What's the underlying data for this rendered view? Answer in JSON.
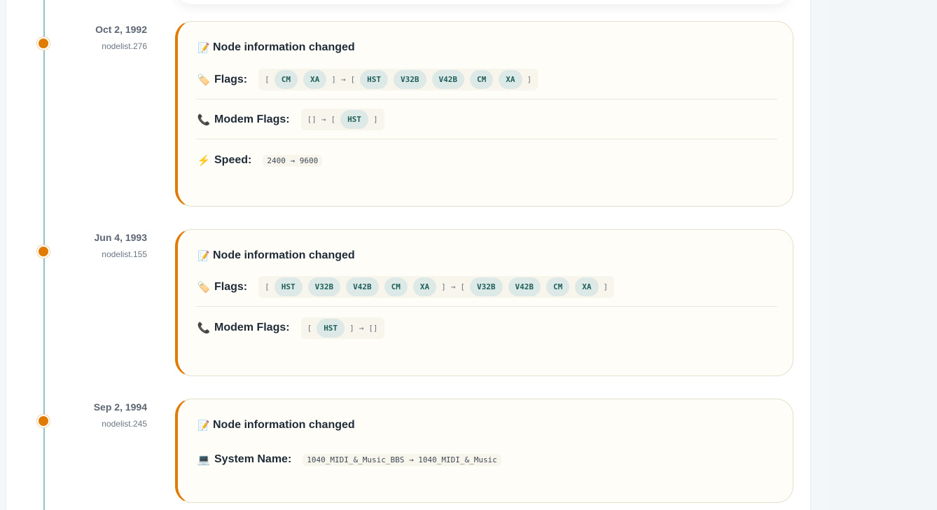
{
  "entries": [
    {
      "date": "Oct 2, 1992",
      "source": "nodelist.276",
      "title": "Node information changed",
      "rows": [
        {
          "label": "Flags:",
          "icon": "tag-icon",
          "from": [
            "CM",
            "XA"
          ],
          "to": [
            "HST",
            "V32B",
            "V42B",
            "CM",
            "XA"
          ]
        },
        {
          "label": "Modem Flags:",
          "icon": "phone-icon",
          "from": [],
          "to": [
            "HST"
          ]
        },
        {
          "label": "Speed:",
          "icon": "lightning-icon",
          "text": "2400 → 9600"
        }
      ]
    },
    {
      "date": "Jun 4, 1993",
      "source": "nodelist.155",
      "title": "Node information changed",
      "rows": [
        {
          "label": "Flags:",
          "icon": "tag-icon",
          "from": [
            "HST",
            "V32B",
            "V42B",
            "CM",
            "XA"
          ],
          "to": [
            "V32B",
            "V42B",
            "CM",
            "XA"
          ]
        },
        {
          "label": "Modem Flags:",
          "icon": "phone-icon",
          "from": [
            "HST"
          ],
          "to": []
        }
      ]
    },
    {
      "date": "Sep 2, 1994",
      "source": "nodelist.245",
      "title": "Node information changed",
      "rows": [
        {
          "label": "System Name:",
          "icon": "computer-icon",
          "text": "1040_MIDI_&_Music_BBS → 1040_MIDI_&_Music"
        }
      ]
    }
  ],
  "colors": {
    "accent": "#e07b00",
    "timeline": "#8fc3c6",
    "chip_bg": "#dde9e6",
    "chip_text": "#1e5f5c"
  }
}
